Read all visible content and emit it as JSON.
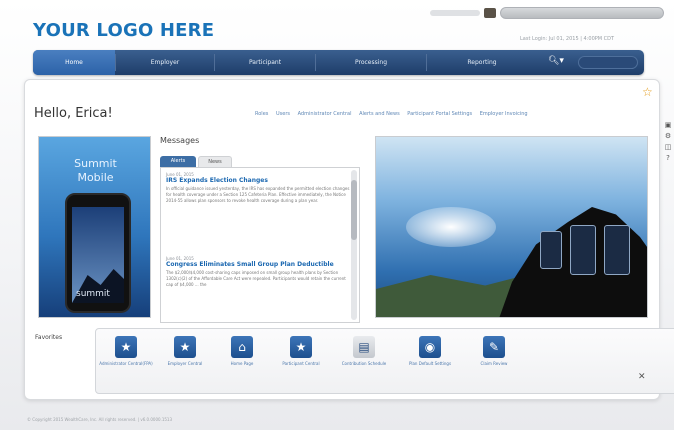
{
  "header": {
    "logo_text": "YOUR LOGO HERE",
    "last_login": "Last Login: Jul 01, 2015 | 4:00PM CDT"
  },
  "nav": {
    "items": [
      "Home",
      "Employer",
      "Participant",
      "Processing",
      "Reporting"
    ],
    "search_icon": "search-icon"
  },
  "greeting": "Hello, Erica!",
  "top_links": [
    "Roles",
    "Users",
    "Administrator Central",
    "Alerts and News",
    "Participant Portal Settings",
    "Employer Invoicing"
  ],
  "side_icons": [
    "calendar-icon",
    "gear-icon",
    "document-icon",
    "help-icon"
  ],
  "promo_left": {
    "line1": "Summit",
    "line2": "Mobile",
    "phone_word": "summit"
  },
  "messages": {
    "title": "Messages",
    "tabs": [
      "Alerts",
      "News"
    ],
    "entries": [
      {
        "date": "June 01, 2015",
        "title": "IRS Expands Election Changes",
        "body": "In official guidance issued yesterday, the IRS has expanded the permitted election changes for health coverage under a Section 125 Cafeteria Plan. Effective immediately, the Notice 2014-55 allows plan sponsors to revoke health coverage during a plan year."
      },
      {
        "date": "June 01, 2015",
        "title": "Congress Eliminates Small Group Plan Deductible",
        "body": "The $2,000/$4,000 cost-sharing caps imposed on small group health plans by Section 1302(c)(2) of the Affordable Care Act were repealed. Participants would retain the current cap of $4,000 ... the"
      }
    ]
  },
  "favorites": {
    "label": "Favorites",
    "items": [
      {
        "name": "Administrator Central(FPA)",
        "icon": "star-icon"
      },
      {
        "name": "Employer Central",
        "icon": "star-icon"
      },
      {
        "name": "Home Page",
        "icon": "home-icon"
      },
      {
        "name": "Participant Central",
        "icon": "star-icon"
      },
      {
        "name": "Contribution Schedule",
        "icon": "calendar-icon"
      },
      {
        "name": "Plan Default Settings",
        "icon": "piggy-bank-icon"
      },
      {
        "name": "Claim Review",
        "icon": "edit-icon"
      }
    ]
  },
  "footer": "© Copyright 2015 WealthCare, Inc. All rights reserved. | v6.0.0000.1513",
  "colors": {
    "brand_blue": "#1a73b8",
    "nav_dark": "#1e3d69",
    "link_blue": "#5f87b5",
    "accent_star": "#e39b19"
  }
}
